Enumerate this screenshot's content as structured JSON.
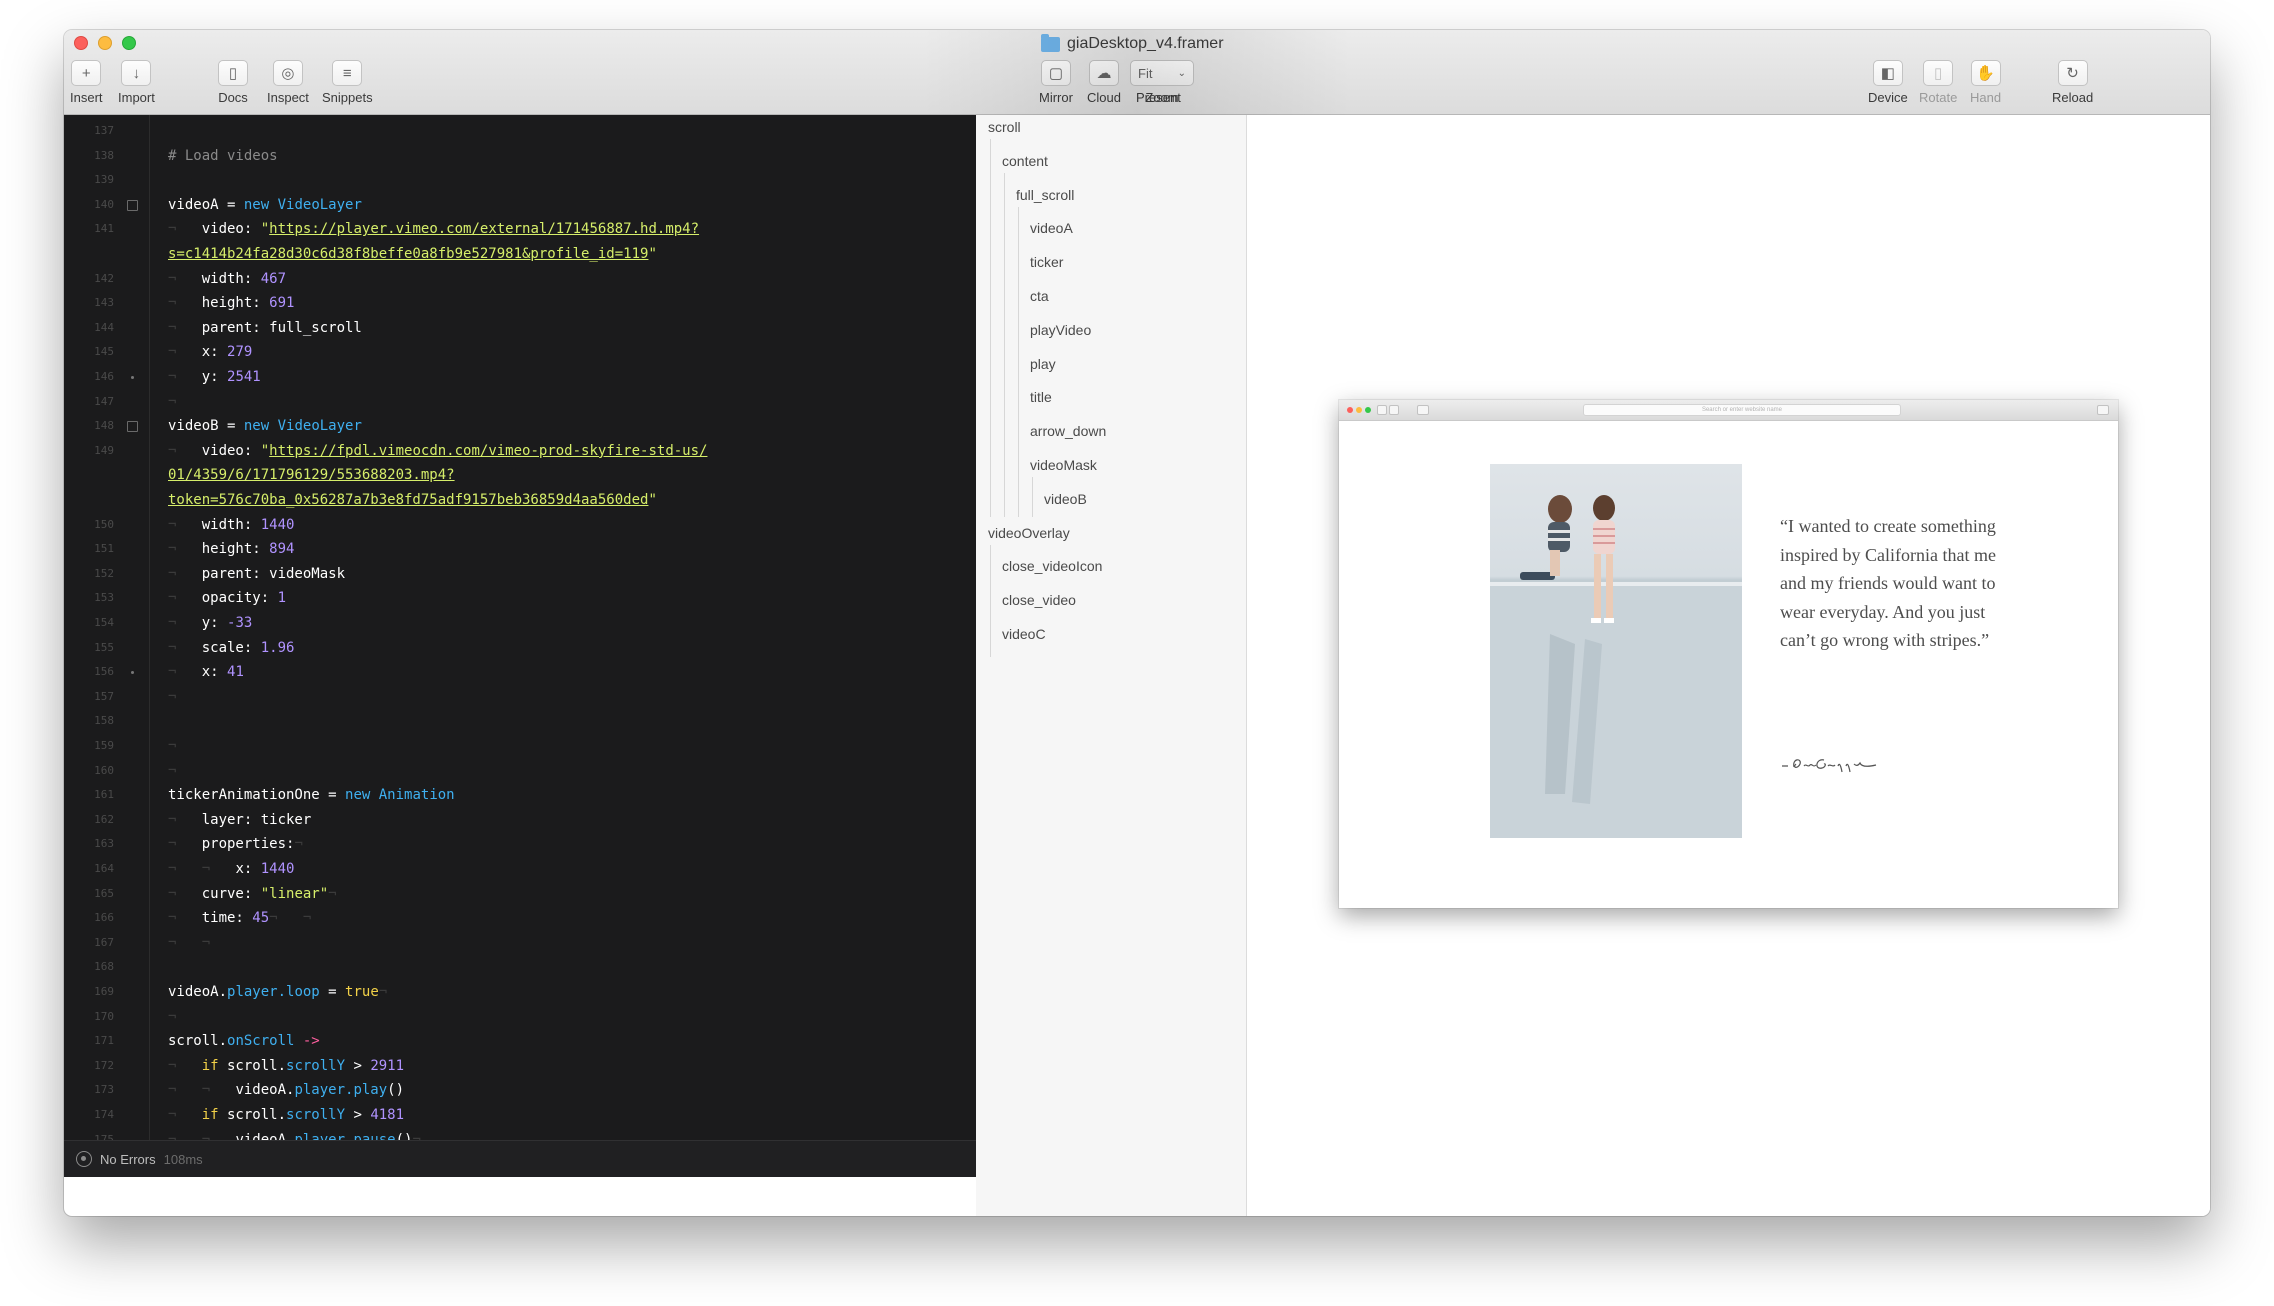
{
  "window": {
    "title": "giaDesktop_v4.framer"
  },
  "toolbar": {
    "left": [
      {
        "label": "Insert",
        "icon": "plus-icon",
        "glyph": "+"
      },
      {
        "label": "Import",
        "icon": "download-icon",
        "glyph": "↓"
      },
      {
        "label": "Docs",
        "icon": "sidebar-icon",
        "glyph": "▯"
      },
      {
        "label": "Inspect",
        "icon": "target-icon",
        "glyph": "◎"
      },
      {
        "label": "Snippets",
        "icon": "lines-icon",
        "glyph": "≡"
      }
    ],
    "center": [
      {
        "label": "Mirror",
        "icon": "mirror-icon",
        "glyph": "▢"
      },
      {
        "label": "Cloud",
        "icon": "cloud-icon",
        "glyph": "☁"
      },
      {
        "label": "Present",
        "icon": "play-icon",
        "glyph": "▷"
      }
    ],
    "right": [
      {
        "label": "Device",
        "icon": "device-icon",
        "glyph": "◧",
        "disabled": false
      },
      {
        "label": "Rotate",
        "icon": "rotate-icon",
        "glyph": "▯",
        "disabled": true
      },
      {
        "label": "Hand",
        "icon": "hand-icon",
        "glyph": "✋",
        "disabled": true
      },
      {
        "label": "Reload",
        "icon": "reload-icon",
        "glyph": "↻",
        "disabled": false
      }
    ],
    "zoom": {
      "label": "Zoom",
      "value": "Fit"
    }
  },
  "editor": {
    "first_line": 137,
    "lines": [
      {
        "n": 137,
        "tokens": []
      },
      {
        "n": 138,
        "tokens": [
          {
            "t": "# Load videos",
            "c": "comment"
          }
        ]
      },
      {
        "n": 139,
        "tokens": []
      },
      {
        "n": 140,
        "fold": true,
        "tokens": [
          {
            "t": "videoA",
            "c": "var"
          },
          {
            "t": " = ",
            "c": "var"
          },
          {
            "t": "new",
            "c": "kw"
          },
          {
            "t": " VideoLayer",
            "c": "cls"
          }
        ]
      },
      {
        "n": 141,
        "tokens": [
          {
            "t": "¬   ",
            "c": "ind"
          },
          {
            "t": "video: ",
            "c": "key"
          },
          {
            "t": "\"",
            "c": "str"
          },
          {
            "t": "https://player.vimeo.com/external/171456887.hd.mp4?",
            "c": "url"
          }
        ]
      },
      {
        "n": null,
        "tokens": [
          {
            "t": "s=c1414b24fa28d30c6d38f8beffe0a8fb9e527981&profile_id=119",
            "c": "url"
          },
          {
            "t": "\"",
            "c": "str"
          }
        ]
      },
      {
        "n": 142,
        "tokens": [
          {
            "t": "¬   ",
            "c": "ind"
          },
          {
            "t": "width: ",
            "c": "key"
          },
          {
            "t": "467",
            "c": "num"
          }
        ]
      },
      {
        "n": 143,
        "tokens": [
          {
            "t": "¬   ",
            "c": "ind"
          },
          {
            "t": "height: ",
            "c": "key"
          },
          {
            "t": "691",
            "c": "num"
          }
        ]
      },
      {
        "n": 144,
        "tokens": [
          {
            "t": "¬   ",
            "c": "ind"
          },
          {
            "t": "parent: full_scroll",
            "c": "key"
          }
        ]
      },
      {
        "n": 145,
        "tokens": [
          {
            "t": "¬   ",
            "c": "ind"
          },
          {
            "t": "x: ",
            "c": "key"
          },
          {
            "t": "279",
            "c": "num"
          }
        ]
      },
      {
        "n": 146,
        "dot": true,
        "tokens": [
          {
            "t": "¬   ",
            "c": "ind"
          },
          {
            "t": "y: ",
            "c": "key"
          },
          {
            "t": "2541",
            "c": "num"
          }
        ]
      },
      {
        "n": 147,
        "tokens": [
          {
            "t": "¬",
            "c": "ind"
          }
        ]
      },
      {
        "n": 148,
        "fold": true,
        "tokens": [
          {
            "t": "videoB",
            "c": "var"
          },
          {
            "t": " = ",
            "c": "var"
          },
          {
            "t": "new",
            "c": "kw"
          },
          {
            "t": " VideoLayer",
            "c": "cls"
          }
        ]
      },
      {
        "n": 149,
        "tokens": [
          {
            "t": "¬   ",
            "c": "ind"
          },
          {
            "t": "video: ",
            "c": "key"
          },
          {
            "t": "\"",
            "c": "str"
          },
          {
            "t": "https://fpdl.vimeocdn.com/vimeo-prod-skyfire-std-us/",
            "c": "url"
          }
        ]
      },
      {
        "n": null,
        "tokens": [
          {
            "t": "01/4359/6/171796129/553688203.mp4?",
            "c": "url"
          }
        ]
      },
      {
        "n": null,
        "tokens": [
          {
            "t": "token=576c70ba_0x56287a7b3e8fd75adf9157beb36859d4aa560ded",
            "c": "url"
          },
          {
            "t": "\"",
            "c": "str"
          }
        ]
      },
      {
        "n": 150,
        "tokens": [
          {
            "t": "¬   ",
            "c": "ind"
          },
          {
            "t": "width: ",
            "c": "key"
          },
          {
            "t": "1440",
            "c": "num"
          }
        ]
      },
      {
        "n": 151,
        "tokens": [
          {
            "t": "¬   ",
            "c": "ind"
          },
          {
            "t": "height: ",
            "c": "key"
          },
          {
            "t": "894",
            "c": "num"
          }
        ]
      },
      {
        "n": 152,
        "tokens": [
          {
            "t": "¬   ",
            "c": "ind"
          },
          {
            "t": "parent: videoMask",
            "c": "key"
          }
        ]
      },
      {
        "n": 153,
        "tokens": [
          {
            "t": "¬   ",
            "c": "ind"
          },
          {
            "t": "opacity: ",
            "c": "key"
          },
          {
            "t": "1",
            "c": "num"
          }
        ]
      },
      {
        "n": 154,
        "tokens": [
          {
            "t": "¬   ",
            "c": "ind"
          },
          {
            "t": "y: ",
            "c": "key"
          },
          {
            "t": "-33",
            "c": "num"
          }
        ]
      },
      {
        "n": 155,
        "tokens": [
          {
            "t": "¬   ",
            "c": "ind"
          },
          {
            "t": "scale: ",
            "c": "key"
          },
          {
            "t": "1.96",
            "c": "num"
          }
        ]
      },
      {
        "n": 156,
        "dot": true,
        "tokens": [
          {
            "t": "¬   ",
            "c": "ind"
          },
          {
            "t": "x: ",
            "c": "key"
          },
          {
            "t": "41",
            "c": "num"
          }
        ]
      },
      {
        "n": 157,
        "tokens": [
          {
            "t": "¬",
            "c": "ind"
          }
        ]
      },
      {
        "n": 158,
        "tokens": []
      },
      {
        "n": 159,
        "tokens": [
          {
            "t": "¬",
            "c": "ind"
          }
        ]
      },
      {
        "n": 160,
        "tokens": [
          {
            "t": "¬",
            "c": "ind"
          }
        ]
      },
      {
        "n": 161,
        "tokens": [
          {
            "t": "tickerAnimationOne",
            "c": "var"
          },
          {
            "t": " = ",
            "c": "var"
          },
          {
            "t": "new",
            "c": "kw"
          },
          {
            "t": " Animation",
            "c": "cls"
          }
        ]
      },
      {
        "n": 162,
        "tokens": [
          {
            "t": "¬   ",
            "c": "ind"
          },
          {
            "t": "layer: ticker",
            "c": "key"
          }
        ]
      },
      {
        "n": 163,
        "tokens": [
          {
            "t": "¬   ",
            "c": "ind"
          },
          {
            "t": "properties:",
            "c": "key"
          },
          {
            "t": "¬",
            "c": "ind"
          }
        ]
      },
      {
        "n": 164,
        "tokens": [
          {
            "t": "¬   ¬   ",
            "c": "ind"
          },
          {
            "t": "x: ",
            "c": "key"
          },
          {
            "t": "1440",
            "c": "num"
          }
        ]
      },
      {
        "n": 165,
        "tokens": [
          {
            "t": "¬   ",
            "c": "ind"
          },
          {
            "t": "curve: ",
            "c": "key"
          },
          {
            "t": "\"linear\"",
            "c": "str"
          },
          {
            "t": "¬",
            "c": "ind"
          }
        ]
      },
      {
        "n": 166,
        "tokens": [
          {
            "t": "¬   ",
            "c": "ind"
          },
          {
            "t": "time: ",
            "c": "key"
          },
          {
            "t": "45",
            "c": "num"
          },
          {
            "t": "¬   ¬",
            "c": "ind"
          }
        ]
      },
      {
        "n": 167,
        "tokens": [
          {
            "t": "¬   ¬",
            "c": "ind"
          }
        ]
      },
      {
        "n": 168,
        "tokens": []
      },
      {
        "n": 169,
        "tokens": [
          {
            "t": "videoA.",
            "c": "var"
          },
          {
            "t": "player.loop",
            "c": "prop"
          },
          {
            "t": " = ",
            "c": "var"
          },
          {
            "t": "true",
            "c": "bool"
          },
          {
            "t": "¬",
            "c": "ind"
          }
        ]
      },
      {
        "n": 170,
        "tokens": [
          {
            "t": "¬",
            "c": "ind"
          }
        ]
      },
      {
        "n": 171,
        "tokens": [
          {
            "t": "scroll.",
            "c": "var"
          },
          {
            "t": "onScroll",
            "c": "prop"
          },
          {
            "t": " ->",
            "c": "arrow"
          }
        ]
      },
      {
        "n": 172,
        "tokens": [
          {
            "t": "¬   ",
            "c": "ind"
          },
          {
            "t": "if",
            "c": "ctl"
          },
          {
            "t": " scroll.",
            "c": "var"
          },
          {
            "t": "scrollY",
            "c": "prop"
          },
          {
            "t": " > ",
            "c": "var"
          },
          {
            "t": "2911",
            "c": "num"
          }
        ]
      },
      {
        "n": 173,
        "tokens": [
          {
            "t": "¬   ¬   ",
            "c": "ind"
          },
          {
            "t": "videoA.",
            "c": "var"
          },
          {
            "t": "player.play",
            "c": "prop"
          },
          {
            "t": "()",
            "c": "var"
          }
        ]
      },
      {
        "n": 174,
        "tokens": [
          {
            "t": "¬   ",
            "c": "ind"
          },
          {
            "t": "if",
            "c": "ctl"
          },
          {
            "t": " scroll.",
            "c": "var"
          },
          {
            "t": "scrollY",
            "c": "prop"
          },
          {
            "t": " > ",
            "c": "var"
          },
          {
            "t": "4181",
            "c": "num"
          }
        ]
      },
      {
        "n": 175,
        "tokens": [
          {
            "t": "¬   ¬   ",
            "c": "ind"
          },
          {
            "t": "videoA.",
            "c": "var"
          },
          {
            "t": "player.pause",
            "c": "prop"
          },
          {
            "t": "()",
            "c": "var"
          },
          {
            "t": "¬",
            "c": "ind"
          }
        ]
      },
      {
        "n": 176,
        "tokens": []
      }
    ]
  },
  "status": {
    "text": "No Errors",
    "time": "108ms"
  },
  "layers": [
    {
      "name": "scroll",
      "depth": 0
    },
    {
      "name": "content",
      "depth": 1
    },
    {
      "name": "full_scroll",
      "depth": 2
    },
    {
      "name": "videoA",
      "depth": 3
    },
    {
      "name": "ticker",
      "depth": 3
    },
    {
      "name": "cta",
      "depth": 3
    },
    {
      "name": "playVideo",
      "depth": 3
    },
    {
      "name": "play",
      "depth": 3
    },
    {
      "name": "title",
      "depth": 3
    },
    {
      "name": "arrow_down",
      "depth": 3
    },
    {
      "name": "videoMask",
      "depth": 3
    },
    {
      "name": "videoB",
      "depth": 4
    },
    {
      "name": "videoOverlay",
      "depth": 0
    },
    {
      "name": "close_videoIcon",
      "depth": 1
    },
    {
      "name": "close_video",
      "depth": 1
    },
    {
      "name": "videoC",
      "depth": 1
    }
  ],
  "preview": {
    "search_placeholder": "Search or enter website name",
    "quote": "“I wanted to create something inspired by California that me and my friends would want to wear everyday. And you just can’t go wrong with stripes.”",
    "signature": "– Gia Coppola"
  }
}
